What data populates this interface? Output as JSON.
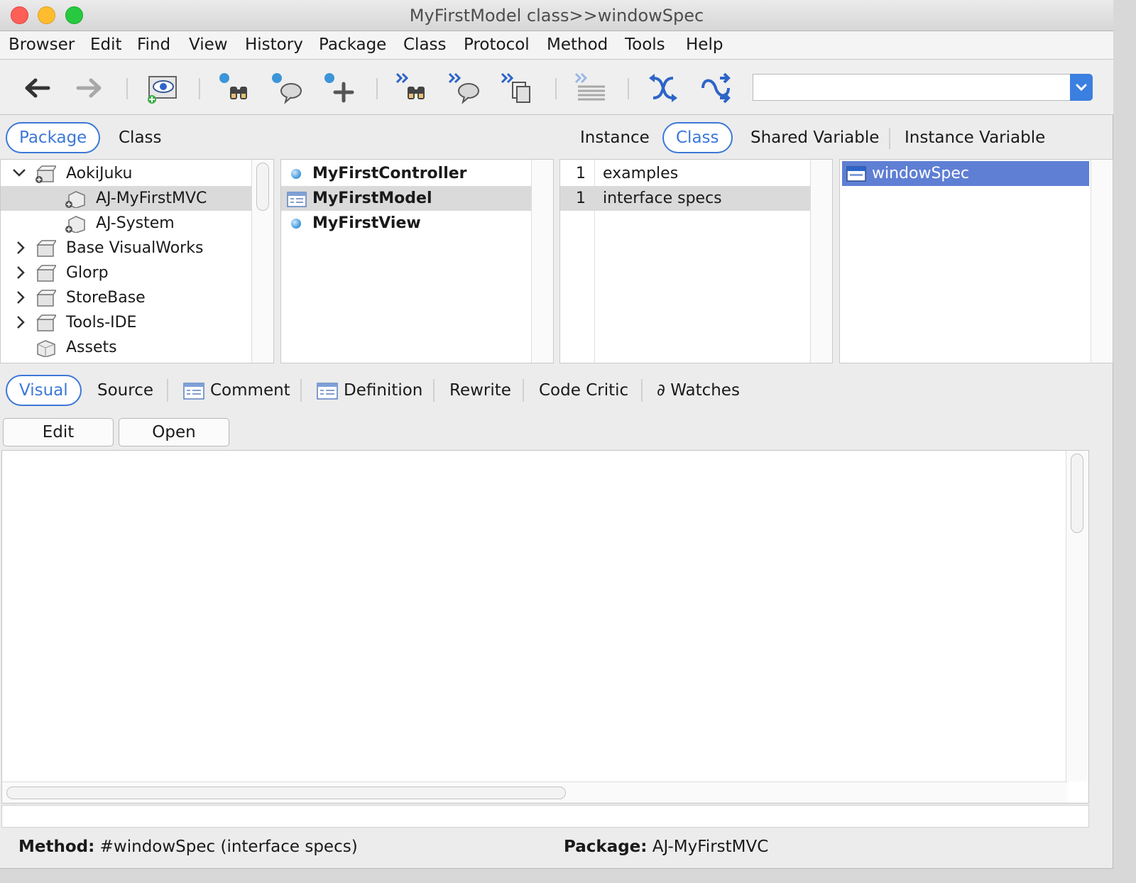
{
  "window": {
    "title": "MyFirstModel class>>windowSpec"
  },
  "menubar": [
    "Browser",
    "Edit",
    "Find",
    "View",
    "History",
    "Package",
    "Class",
    "Protocol",
    "Method",
    "Tools",
    "Help"
  ],
  "toolbar": {
    "search_value": ""
  },
  "nav_tabs": {
    "package": "Package",
    "class": "Class"
  },
  "side_tabs": {
    "instance": "Instance",
    "class": "Class",
    "shared_variable": "Shared Variable",
    "instance_variable": "Instance Variable"
  },
  "packages": [
    {
      "label": "AokiJuku",
      "expanded": true
    },
    {
      "label": "AJ-MyFirstMVC",
      "selected": true
    },
    {
      "label": "AJ-System"
    },
    {
      "label": "Base VisualWorks"
    },
    {
      "label": "Glorp"
    },
    {
      "label": "StoreBase"
    },
    {
      "label": "Tools-IDE"
    },
    {
      "label": "Assets"
    }
  ],
  "classes": [
    {
      "label": "MyFirstController"
    },
    {
      "label": "MyFirstModel",
      "selected": true
    },
    {
      "label": "MyFirstView"
    }
  ],
  "protocols": [
    {
      "count": "1",
      "label": "examples"
    },
    {
      "count": "1",
      "label": "interface specs",
      "selected": true
    }
  ],
  "methods": [
    {
      "label": "windowSpec",
      "selected": true
    }
  ],
  "code_tabs": {
    "visual": "Visual",
    "source": "Source",
    "comment": "Comment",
    "definition": "Definition",
    "rewrite": "Rewrite",
    "code_critic": "Code Critic",
    "watches": "∂ Watches"
  },
  "buttons": {
    "edit": "Edit",
    "open": "Open"
  },
  "status": {
    "method_label": "Method:",
    "method_value": " #windowSpec (interface specs)",
    "package_label": "Package:",
    "package_value": " AJ-MyFirstMVC"
  },
  "colors": {
    "accent": "#3c78d8",
    "selection": "#5f7fd4",
    "row_selected": "#dadada"
  }
}
